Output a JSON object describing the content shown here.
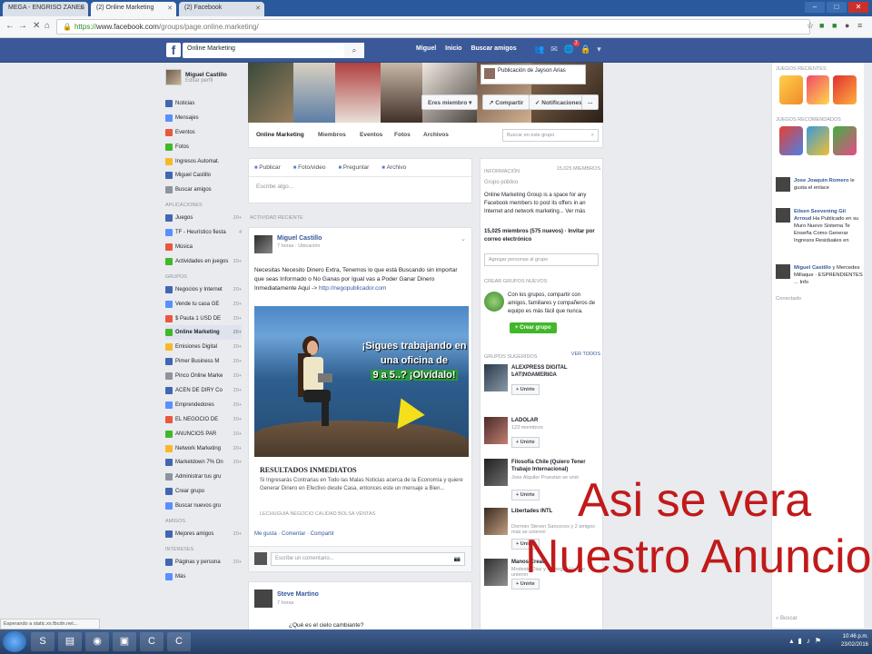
{
  "browser": {
    "tabs": [
      {
        "label": "MEGA - ENGRISO ZANES"
      },
      {
        "label": "(2) Online Marketing"
      },
      {
        "label": "(2) Facebook"
      }
    ],
    "url_scheme": "https://",
    "url_host": "www.facebook.com",
    "url_path": "/groups/page.online.marketing/",
    "status_text": "Esperando a static.xx.fbcdn.net..."
  },
  "fb": {
    "search_value": "Online Marketing",
    "nav": [
      "Miguel",
      "Inicio",
      "Buscar amigos"
    ],
    "notif_count": "7"
  },
  "sidebar": {
    "name": "Miguel Castillo",
    "sub": "Editar perfil",
    "favorites": [
      {
        "label": "Noticias"
      },
      {
        "label": "Mensajes"
      },
      {
        "label": "Eventos"
      },
      {
        "label": "Fotos"
      },
      {
        "label": "Ingresos Automat."
      },
      {
        "label": "Miguel Castillo"
      },
      {
        "label": "Buscar amigos"
      }
    ],
    "apps_header": "Aplicaciones",
    "apps": [
      {
        "label": "Juegos",
        "count": "20+"
      },
      {
        "label": "TF - Heurístico fiesta",
        "count": "4"
      },
      {
        "label": "Música"
      },
      {
        "label": "Actividades en juegos",
        "count": "20+"
      }
    ],
    "groups_header": "Grupos",
    "groups": [
      {
        "label": "Negocios y Internet",
        "count": "20+"
      },
      {
        "label": "Vende tu casa GE",
        "count": "20+"
      },
      {
        "label": "$ Pauta 1 USD DE",
        "count": "20+"
      },
      {
        "label": "Online Marketing",
        "count": "20+",
        "selected": true
      },
      {
        "label": "Emisiones Digital",
        "count": "20+"
      },
      {
        "label": "Pimer Business M",
        "count": "20+"
      },
      {
        "label": "Pinco Online Marke",
        "count": "20+"
      },
      {
        "label": "ACEN DE DIRY Co",
        "count": "20+"
      },
      {
        "label": "Emprendedores",
        "count": "20+"
      },
      {
        "label": "EL NEGOCIO DE",
        "count": "20+"
      },
      {
        "label": "ANUNCIOS PAR",
        "count": "20+"
      },
      {
        "label": "Network Marketing",
        "count": "20+"
      },
      {
        "label": "Marketdown 7% On",
        "count": "20+"
      },
      {
        "label": "Administrar tus gru"
      },
      {
        "label": "Crear grupo"
      },
      {
        "label": "Buscar nuevos gru"
      }
    ],
    "friends_header": "Amigos",
    "friends": [
      {
        "label": "Mejores amigos",
        "count": "20+"
      }
    ],
    "interests_header": "Intereses",
    "interests": [
      {
        "label": "Páginas y persona",
        "count": "20+"
      },
      {
        "label": "Más"
      }
    ]
  },
  "group": {
    "cover_notif": "Publicación de Jayson Arias",
    "join_btn": "Eres miembro",
    "share_btn": "Compartir",
    "notif_btn": "Notificaciones",
    "more_btn": "...",
    "tabs": [
      "Online Marketing",
      "Miembros",
      "Eventos",
      "Fotos",
      "Archivos"
    ],
    "search_placeholder": "Buscar en este grupo"
  },
  "composer": {
    "tabs": [
      "Publicar",
      "Foto/video",
      "Preguntar",
      "Archivo"
    ],
    "placeholder": "Escribe algo..."
  },
  "feed": {
    "section": "Actividad reciente",
    "post": {
      "author": "Miguel Castillo",
      "meta": "7 horas · Ubicación",
      "text": "Necesitas Necesito Dinero Extra, Tenemos lo que está Buscando sin importar que seas Informado o No Ganas por Igual vas a Poder Ganar Dinero Inmediatamente Aquí ->",
      "link": "http://negopublicador.com",
      "ad_headline_1": "¡Sigues trabajando en una oficina de",
      "ad_headline_2": "9 a 5..? ¡Olvídalo!",
      "ad_title": "RESULTADOS INMEDIATOS",
      "ad_desc": "Si Ingresarás Contrarias en Todo las Malas Noticias acerca de la Economía y quiere Generar Dinero en Efectivo desde Casa, entonces este un mensaje a Bien...",
      "ad_domain": "LECHUGUIA NEGOCIO CALIDAD BOLSA VENTAS",
      "actions": "Me gusta · Comentar · Compartir",
      "comment_placeholder": "Escribe un comentario..."
    },
    "post2": {
      "author": "Steve Martino",
      "meta": "7 horas",
      "text": "¿Qué es el cielo cambiante?"
    }
  },
  "info": {
    "header": "Información",
    "members": "15,025 miembros",
    "type": "Grupo público",
    "desc": "Online Marketing Group is a space for any Facebook members to post its offers in an Internet and network marketing... Ver más",
    "stats": "15,025 miembros (575 nuevos) · Invitar por correo electrónico",
    "add_placeholder": "Agregar personas al grupo",
    "create_header": "Crear grupos nuevos",
    "create_text": "Con los grupos, compartir con amigos, familiares y compañeros de equipo es más fácil que nunca.",
    "create_btn": "+ Crear grupo",
    "suggested_header": "Grupos sugeridos",
    "suggested_link": "Ver todos",
    "suggested": [
      {
        "name": "ALEXPRESS DIGITAL LATINOAMERICA",
        "sub": "Ana y Jose se unió",
        "join": "+ Unirte"
      },
      {
        "name": "LADOLAR",
        "sub": "123 miembros",
        "join": "+ Unirte"
      },
      {
        "name": "Filosofía Chile (Quiero Tener Trabajo Internacional)",
        "sub": "Jose Alquiler Pruestan se unió",
        "join": "+ Unirte"
      },
      {
        "name": "Libertades INTL",
        "sub": "Dormier Steven Sanceces y 2 amigos más se unieron",
        "join": "+ Unirte"
      },
      {
        "name": "Manos Creat",
        "sub": "Modesto Diaz y Fomegas Has se unieron",
        "join": "+ Unirte"
      }
    ]
  },
  "rightbar": {
    "games_header": "Juegos recientes",
    "games2_header": "Juegos recomendados",
    "ticker": [
      {
        "bold": "Jose Joaquin Romero",
        "text": "le gusta el enlace"
      },
      {
        "bold": "Eileen Seevening Gil Arroud",
        "text": "Ha Publicado en su Muro Nuevo Sistema Te Enseña Como Generar Ingresos Residuales en"
      },
      {
        "bold": "Miguel Castillo",
        "text": "y Mercedes Millaque · ESPRENDIENTES ... Info"
      }
    ],
    "ticker_footer": "Conectado",
    "search": "Buscar"
  },
  "overlay": {
    "line1": "Asi se vera",
    "line2": "Nuestro Anuncio"
  },
  "taskbar": {
    "time": "10:46 p.m.",
    "date": "23/02/2016"
  }
}
